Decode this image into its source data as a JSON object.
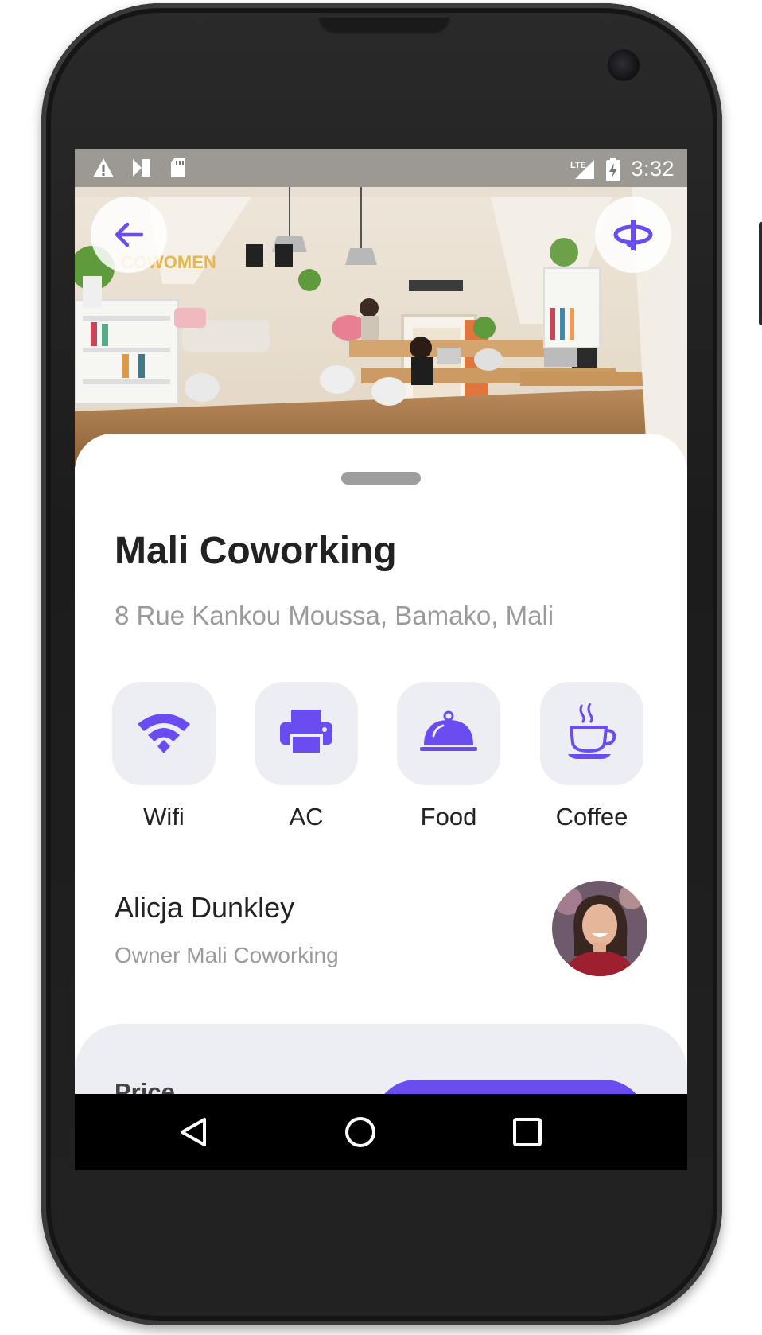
{
  "status_bar": {
    "time": "3:32",
    "network": "LTE"
  },
  "venue": {
    "name": "Mali Coworking",
    "address": "8 Rue Kankou Moussa, Bamako, Mali",
    "hero_sign": "COWOMEN"
  },
  "amenities": [
    {
      "label": "Wifi",
      "icon": "wifi-icon"
    },
    {
      "label": "AC",
      "icon": "printer-icon"
    },
    {
      "label": "Food",
      "icon": "cloche-icon"
    },
    {
      "label": "Coffee",
      "icon": "coffee-cup-icon"
    }
  ],
  "owner": {
    "name": "Alicja Dunkley",
    "role": "Owner Mali Coworking"
  },
  "footer": {
    "price_label": "Price"
  },
  "icons": {
    "back": "arrow-left-icon",
    "view_360": "rotate-360-icon",
    "nav": [
      "nav-back-icon",
      "nav-home-icon",
      "nav-recents-icon"
    ]
  },
  "colors": {
    "accent": "#6a4cf0",
    "tile": "#eceef3",
    "title": "#222222",
    "muted": "#9a9a9a"
  }
}
